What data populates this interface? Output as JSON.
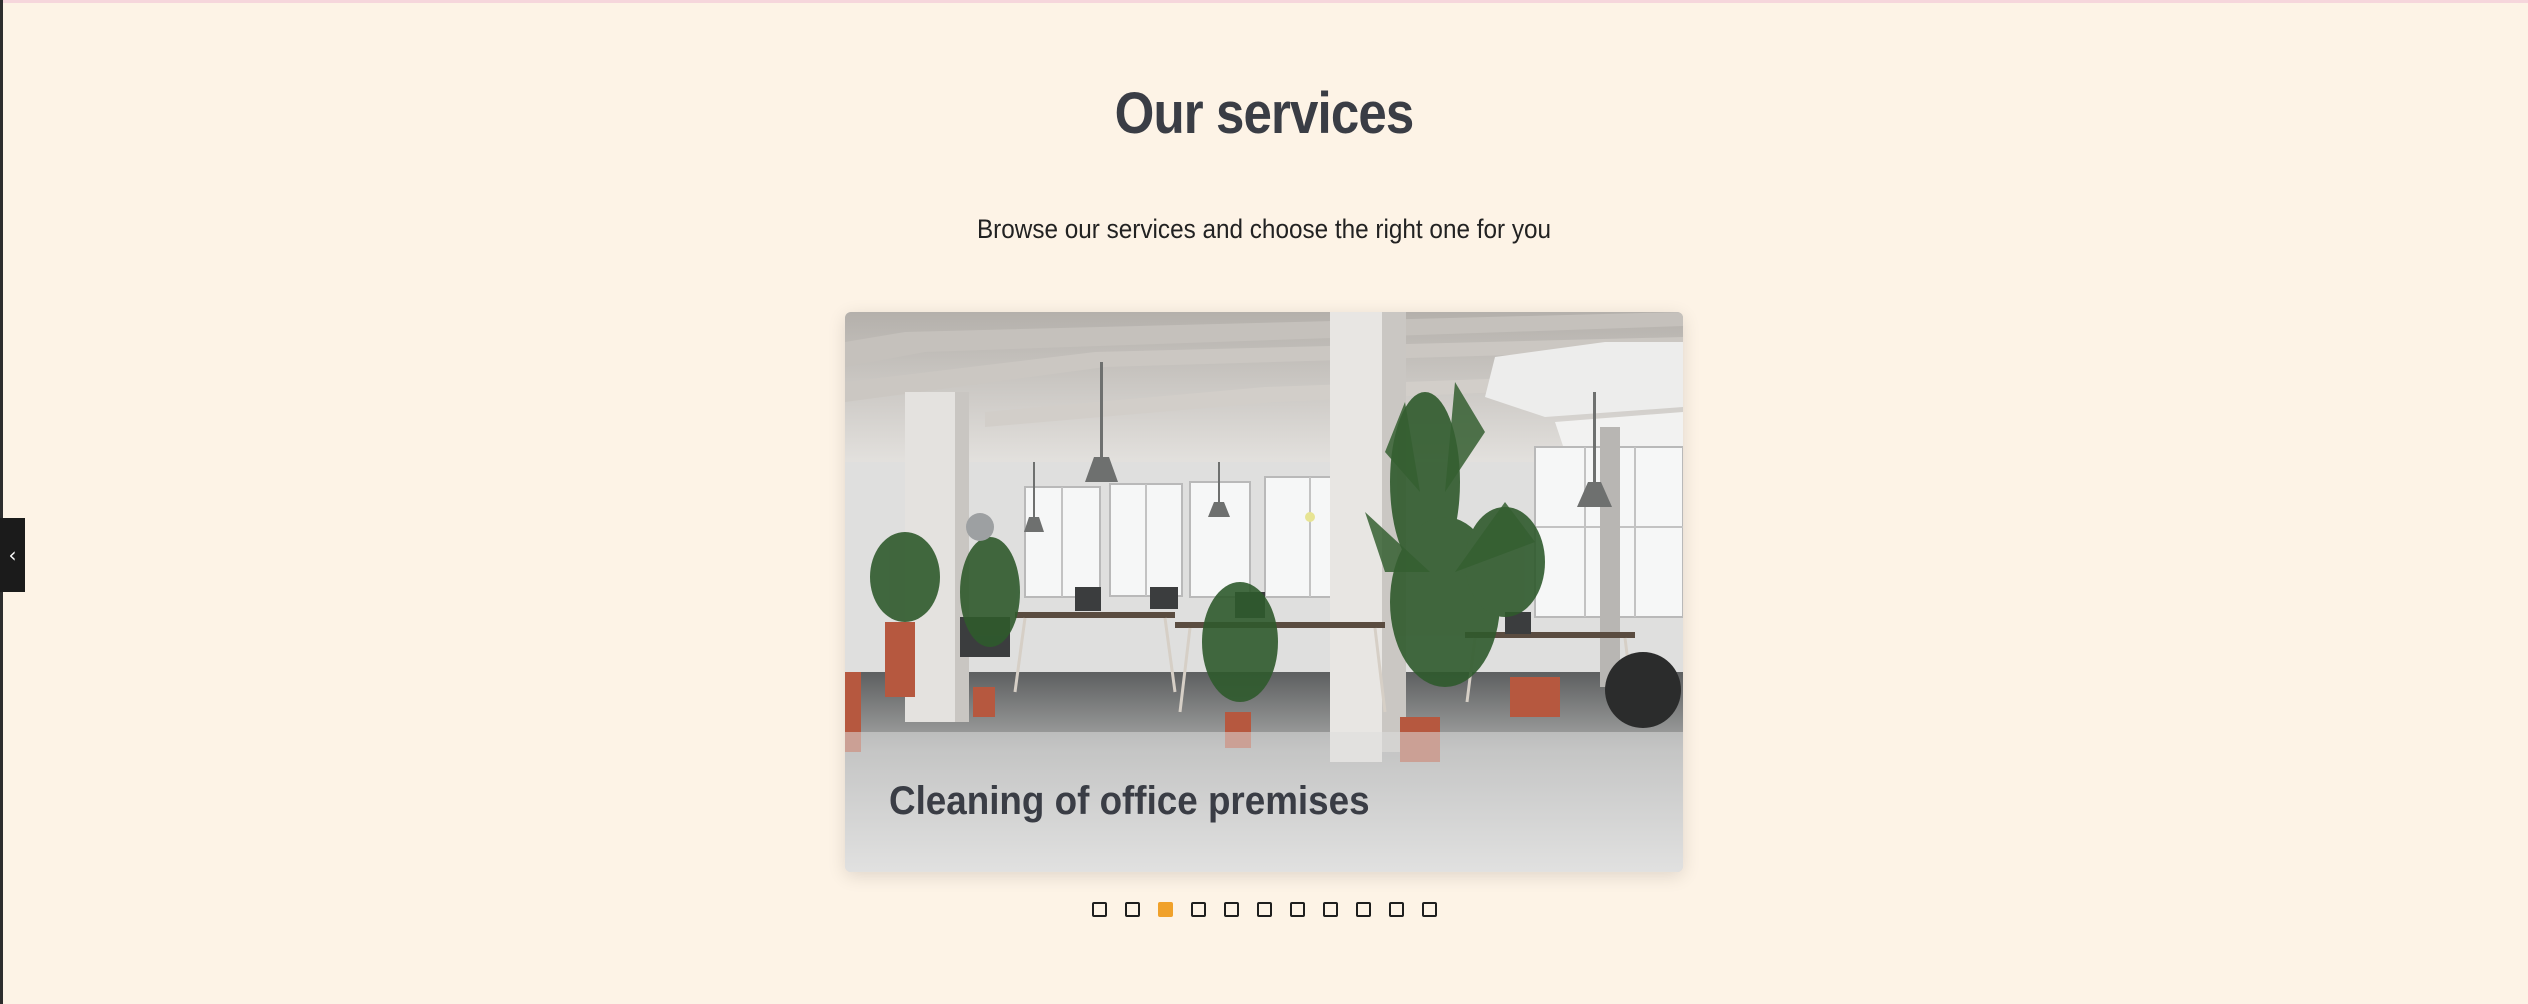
{
  "section": {
    "title": "Our services",
    "subtitle": "Browse our services and choose the right one for you"
  },
  "side_toggle": {
    "icon": "chevron-left-icon",
    "glyph": "‹"
  },
  "carousel": {
    "active_slide": {
      "caption": "Cleaning of office premises"
    },
    "dot_count": 11,
    "active_index": 2,
    "accent_color": "#f0a12b"
  },
  "colors": {
    "background": "#fdf3e6",
    "heading": "#3a3d45"
  }
}
